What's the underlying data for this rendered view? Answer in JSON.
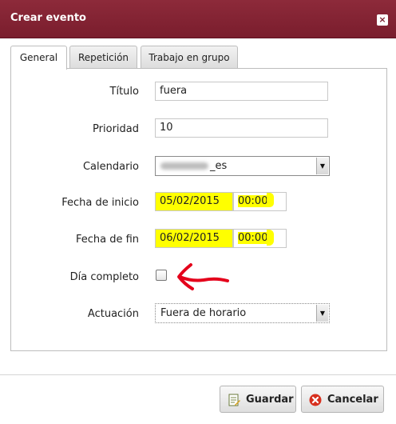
{
  "window": {
    "title": "Crear evento",
    "close_glyph": "×"
  },
  "tabs": [
    {
      "label": "General",
      "active": true
    },
    {
      "label": "Repetición",
      "active": false
    },
    {
      "label": "Trabajo en grupo",
      "active": false
    }
  ],
  "form": {
    "titulo": {
      "label": "Título",
      "value": "fuera"
    },
    "prioridad": {
      "label": "Prioridad",
      "value": "10"
    },
    "calendario": {
      "label": "Calendario",
      "value_suffix": "_es"
    },
    "fecha_inicio": {
      "label": "Fecha de inicio",
      "date": "05/02/2015",
      "time": "00:00"
    },
    "fecha_fin": {
      "label": "Fecha de fin",
      "date": "06/02/2015",
      "time": "00:00"
    },
    "dia_completo": {
      "label": "Día completo",
      "checked": false
    },
    "actuacion": {
      "label": "Actuación",
      "value": "Fuera de horario"
    }
  },
  "buttons": {
    "save": "Guardar",
    "cancel": "Cancelar"
  },
  "colors": {
    "titlebar": "#7a1d2d",
    "highlight": "#ffff00",
    "annotation_arrow": "#e4001b"
  },
  "icons": {
    "save": "save-form-icon",
    "cancel": "cancel-icon"
  }
}
